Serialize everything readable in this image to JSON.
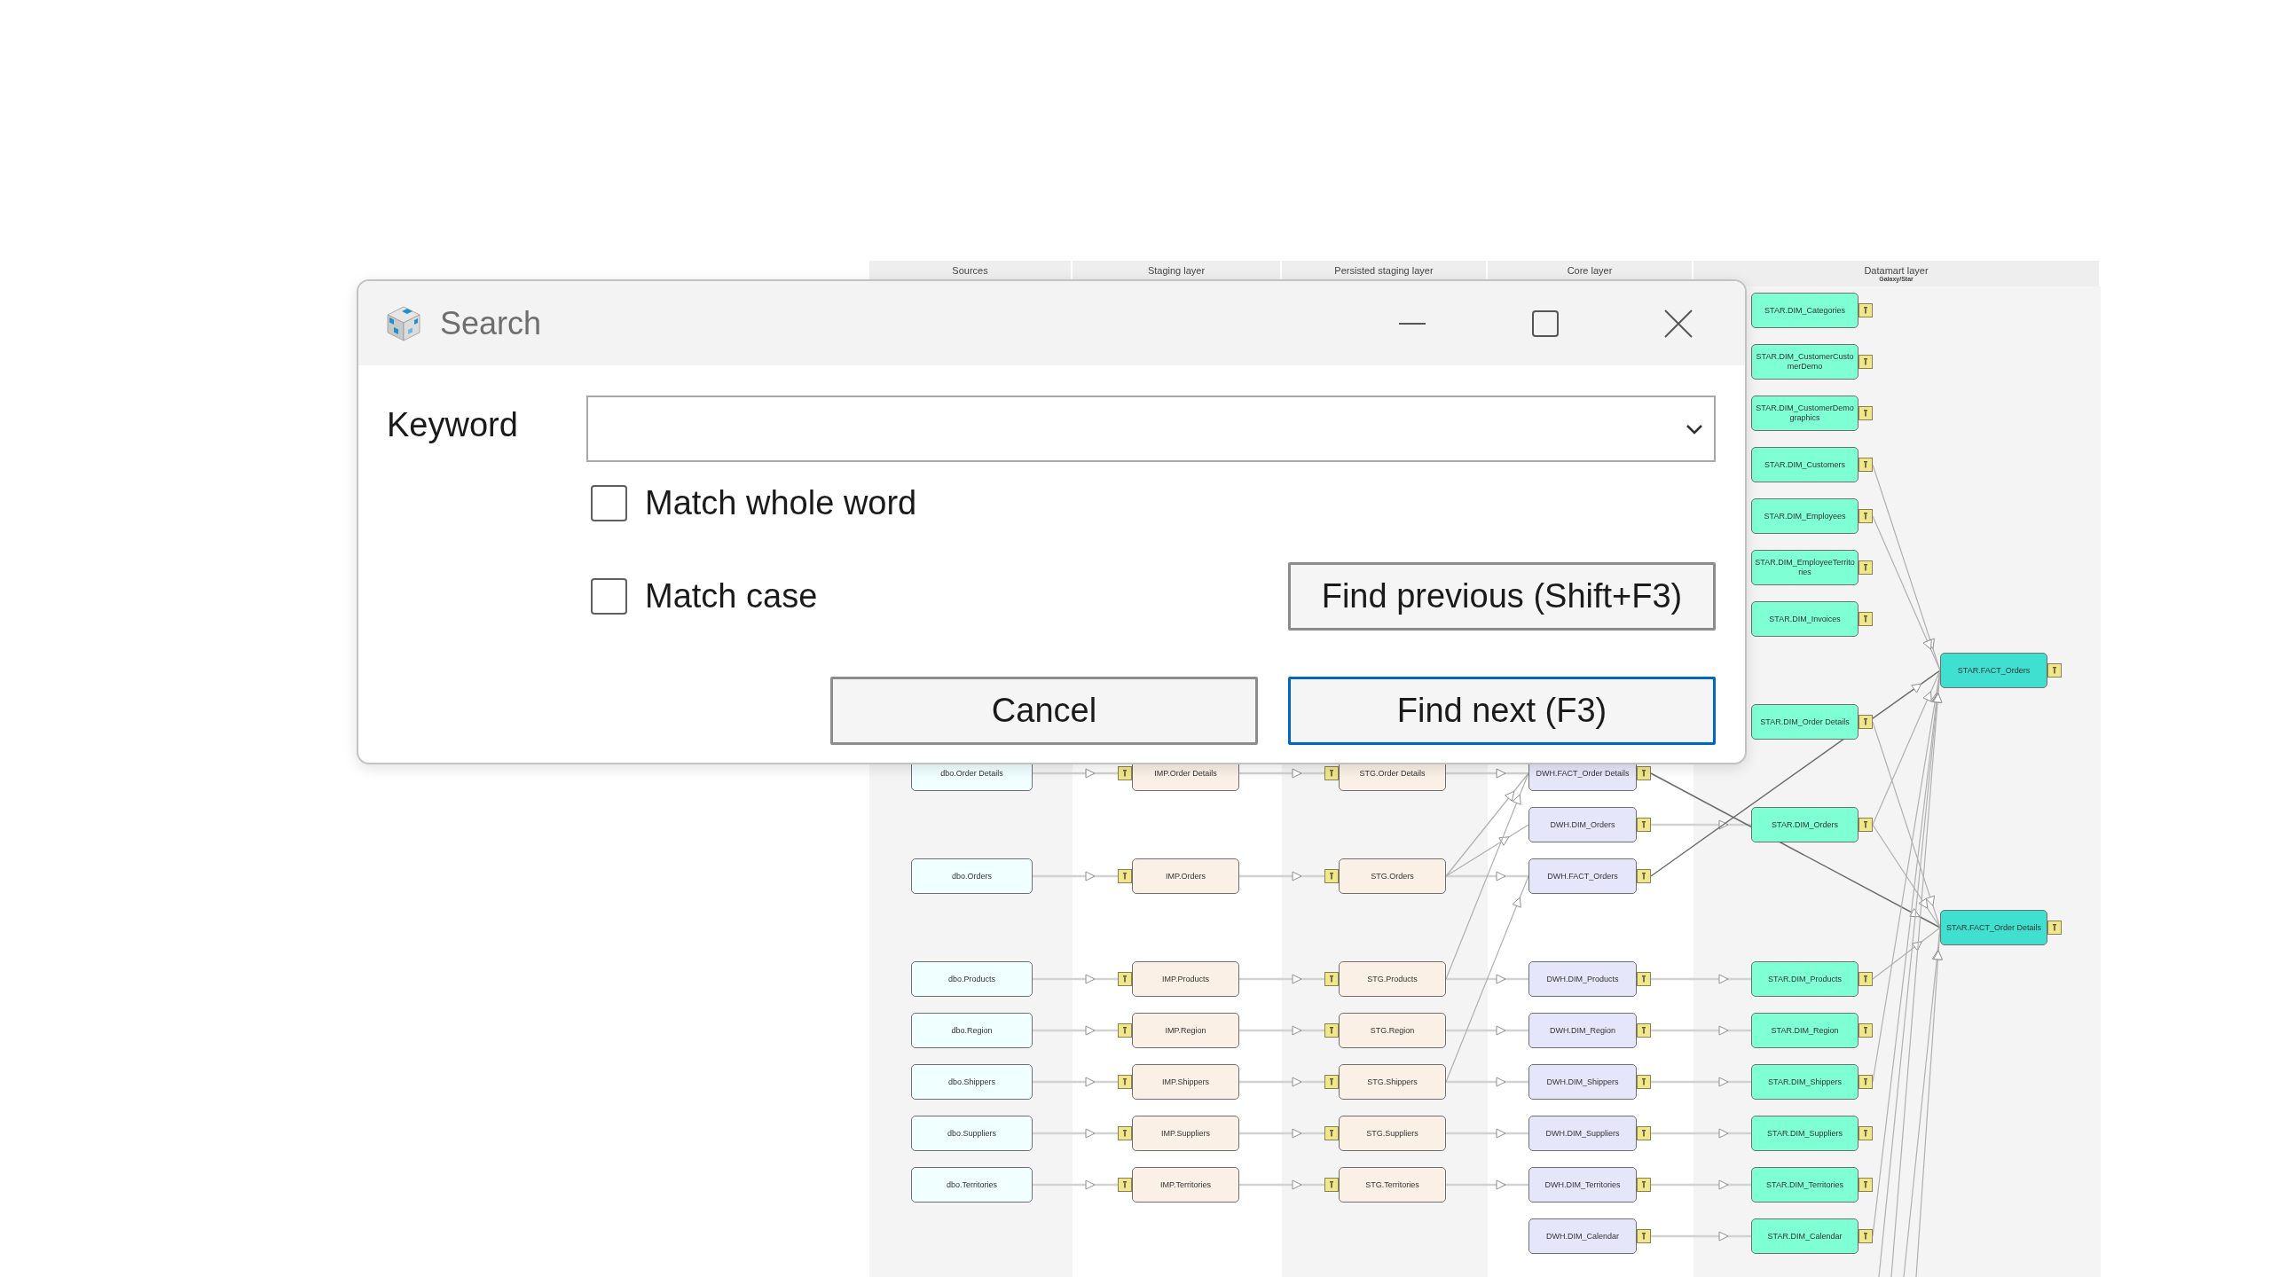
{
  "diagram": {
    "layers": [
      {
        "title": "Sources"
      },
      {
        "title": "Staging layer"
      },
      {
        "title": "Persisted staging layer"
      },
      {
        "title": "Core layer"
      },
      {
        "title": "Datamart layer",
        "subtitle": "Galaxy/Star"
      }
    ],
    "rows": [
      {
        "datamart": {
          "label": "STAR.DIM_Categories",
          "kind": "dim"
        }
      },
      {
        "datamart": {
          "label": "STAR.DIM_CustomerCustomerDemo",
          "kind": "dim"
        }
      },
      {
        "datamart": {
          "label": "STAR.DIM_CustomerDemographics",
          "kind": "dim"
        }
      },
      {
        "datamart": {
          "label": "STAR.DIM_Customers",
          "kind": "dim"
        }
      },
      {
        "datamart": {
          "label": "STAR.DIM_Employees",
          "kind": "dim"
        }
      },
      {
        "datamart": {
          "label": "STAR.DIM_EmployeeTerritories",
          "kind": "dim"
        }
      },
      {
        "datamart": {
          "label": "STAR.DIM_Invoices",
          "kind": "dim"
        }
      },
      {
        "datamart": {
          "label": "STAR.FACT_Orders",
          "kind": "fact"
        }
      },
      {
        "datamart": {
          "label": "STAR.DIM_Order Details",
          "kind": "dim"
        }
      },
      {
        "source": "dbo.Order Details",
        "staging": "IMP.Order Details",
        "persisted": "STG.Order Details",
        "core": "DWH.FACT_Order Details"
      },
      {
        "core": "DWH.DIM_Orders",
        "datamart": {
          "label": "STAR.DIM_Orders",
          "kind": "dim"
        }
      },
      {
        "source": "dbo.Orders",
        "staging": "IMP.Orders",
        "persisted": "STG.Orders",
        "core": "DWH.FACT_Orders"
      },
      {
        "datamart": {
          "label": "STAR.FACT_Order Details",
          "kind": "fact"
        }
      },
      {
        "source": "dbo.Products",
        "staging": "IMP.Products",
        "persisted": "STG.Products",
        "core": "DWH.DIM_Products",
        "datamart": {
          "label": "STAR.DIM_Products",
          "kind": "dim"
        }
      },
      {
        "source": "dbo.Region",
        "staging": "IMP.Region",
        "persisted": "STG.Region",
        "core": "DWH.DIM_Region",
        "datamart": {
          "label": "STAR.DIM_Region",
          "kind": "dim"
        }
      },
      {
        "source": "dbo.Shippers",
        "staging": "IMP.Shippers",
        "persisted": "STG.Shippers",
        "core": "DWH.DIM_Shippers",
        "datamart": {
          "label": "STAR.DIM_Shippers",
          "kind": "dim"
        }
      },
      {
        "source": "dbo.Suppliers",
        "staging": "IMP.Suppliers",
        "persisted": "STG.Suppliers",
        "core": "DWH.DIM_Suppliers",
        "datamart": {
          "label": "STAR.DIM_Suppliers",
          "kind": "dim"
        }
      },
      {
        "source": "dbo.Territories",
        "staging": "IMP.Territories",
        "persisted": "STG.Territories",
        "core": "DWH.DIM_Territories",
        "datamart": {
          "label": "STAR.DIM_Territories",
          "kind": "dim"
        }
      },
      {
        "core": "DWH.DIM_Calendar",
        "datamart": {
          "label": "STAR.DIM_Calendar",
          "kind": "dim"
        }
      }
    ]
  },
  "dialog": {
    "title": "Search",
    "keyword": {
      "label": "Keyword"
    },
    "options": [
      {
        "label": "Match whole word",
        "checked": false
      },
      {
        "label": "Match case",
        "checked": false
      }
    ],
    "buttons": [
      {
        "label": "Find previous (Shift+F3)",
        "focused": false
      },
      {
        "label": "Cancel",
        "focused": false
      },
      {
        "label": "Find next (F3)",
        "focused": true
      }
    ]
  }
}
